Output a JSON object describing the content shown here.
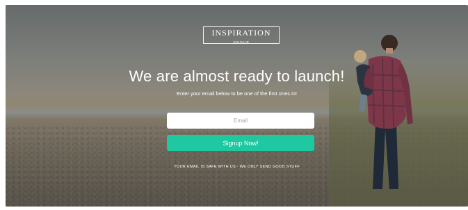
{
  "logo": {
    "name": "INSPIRATION",
    "tagline": "GROUP"
  },
  "hero": {
    "headline": "We are almost ready to launch!",
    "subheadline": "Enter your email below to be one of the first ones in!"
  },
  "signup_form": {
    "email_placeholder": "Email",
    "email_value": "",
    "submit_label": "Signup Now!"
  },
  "footer_note": "YOUR EMAIL IS SAFE WITH US - WE ONLY SEND GOOD STUFF",
  "colors": {
    "accent": "#1ec8a0",
    "text": "#ffffff",
    "input_background": "#ffffff"
  }
}
